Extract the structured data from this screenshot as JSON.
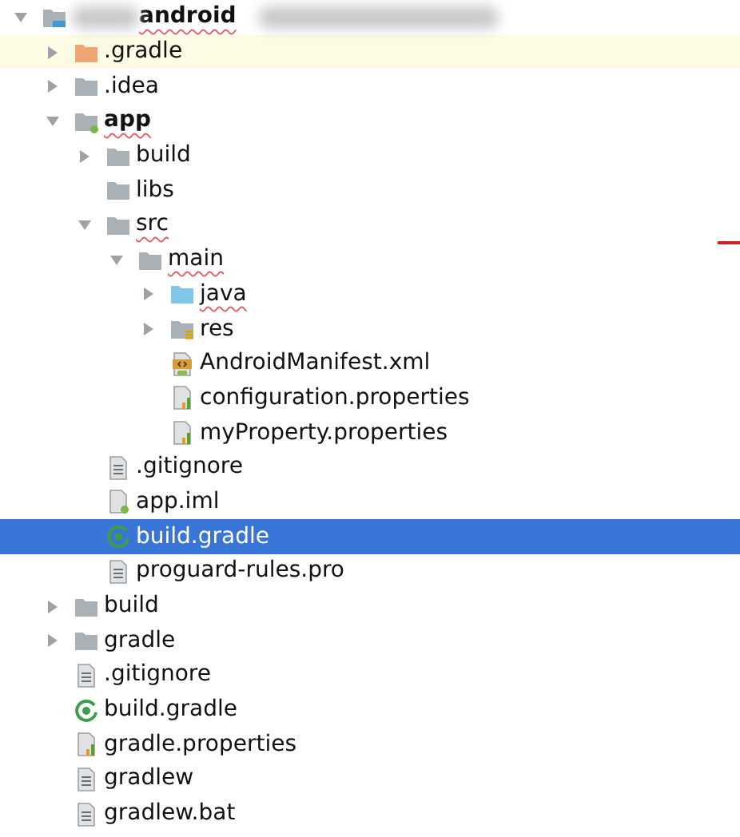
{
  "tree": [
    {
      "label": "android",
      "kind": "project",
      "expanded": true,
      "selected": false,
      "highlighted": false,
      "misspelled": true,
      "bold": true,
      "redacted": true,
      "children": [
        {
          "label": ".gradle",
          "kind": "excluded",
          "expanded": false,
          "selected": false,
          "highlighted": true,
          "misspelled": false,
          "bold": false
        },
        {
          "label": ".idea",
          "kind": "folder",
          "expanded": false,
          "selected": false,
          "highlighted": false,
          "misspelled": false,
          "bold": false
        },
        {
          "label": "app",
          "kind": "module",
          "expanded": true,
          "selected": false,
          "highlighted": false,
          "misspelled": true,
          "bold": true,
          "children": [
            {
              "label": "build",
              "kind": "folder",
              "expanded": false,
              "selected": false,
              "highlighted": false,
              "misspelled": false,
              "bold": false
            },
            {
              "label": "libs",
              "kind": "folder",
              "selected": false,
              "highlighted": false,
              "misspelled": false,
              "bold": false
            },
            {
              "label": "src",
              "kind": "folder",
              "expanded": true,
              "selected": false,
              "highlighted": false,
              "misspelled": true,
              "bold": false,
              "children": [
                {
                  "label": "main",
                  "kind": "folder",
                  "expanded": true,
                  "selected": false,
                  "highlighted": false,
                  "misspelled": true,
                  "bold": false,
                  "children": [
                    {
                      "label": "java",
                      "kind": "source",
                      "expanded": false,
                      "selected": false,
                      "highlighted": false,
                      "misspelled": true,
                      "bold": false
                    },
                    {
                      "label": "res",
                      "kind": "resources",
                      "expanded": false,
                      "selected": false,
                      "highlighted": false,
                      "misspelled": false,
                      "bold": false
                    },
                    {
                      "label": "AndroidManifest.xml",
                      "kind": "manifest",
                      "selected": false,
                      "highlighted": false,
                      "misspelled": false,
                      "bold": false
                    },
                    {
                      "label": "configuration.properties",
                      "kind": "properties",
                      "selected": false,
                      "highlighted": false,
                      "misspelled": false,
                      "bold": false
                    },
                    {
                      "label": "myProperty.properties",
                      "kind": "properties",
                      "selected": false,
                      "highlighted": false,
                      "misspelled": false,
                      "bold": false
                    }
                  ]
                }
              ]
            },
            {
              "label": ".gitignore",
              "kind": "text",
              "selected": false,
              "highlighted": false,
              "misspelled": false,
              "bold": false
            },
            {
              "label": "app.iml",
              "kind": "iml",
              "selected": false,
              "highlighted": false,
              "misspelled": false,
              "bold": false
            },
            {
              "label": "build.gradle",
              "kind": "gradle",
              "selected": true,
              "highlighted": false,
              "misspelled": false,
              "bold": false
            },
            {
              "label": "proguard-rules.pro",
              "kind": "text",
              "selected": false,
              "highlighted": false,
              "misspelled": false,
              "bold": false
            }
          ]
        },
        {
          "label": "build",
          "kind": "folder",
          "expanded": false,
          "selected": false,
          "highlighted": false,
          "misspelled": false,
          "bold": false
        },
        {
          "label": "gradle",
          "kind": "folder",
          "expanded": false,
          "selected": false,
          "highlighted": false,
          "misspelled": false,
          "bold": false
        },
        {
          "label": ".gitignore",
          "kind": "text",
          "selected": false,
          "highlighted": false,
          "misspelled": false,
          "bold": false
        },
        {
          "label": "build.gradle",
          "kind": "gradle",
          "selected": false,
          "highlighted": false,
          "misspelled": false,
          "bold": false
        },
        {
          "label": "gradle.properties",
          "kind": "properties",
          "selected": false,
          "highlighted": false,
          "misspelled": false,
          "bold": false
        },
        {
          "label": "gradlew",
          "kind": "text",
          "selected": false,
          "highlighted": false,
          "misspelled": false,
          "bold": false
        },
        {
          "label": "gradlew.bat",
          "kind": "text",
          "selected": false,
          "highlighted": false,
          "misspelled": false,
          "bold": false
        }
      ]
    }
  ]
}
